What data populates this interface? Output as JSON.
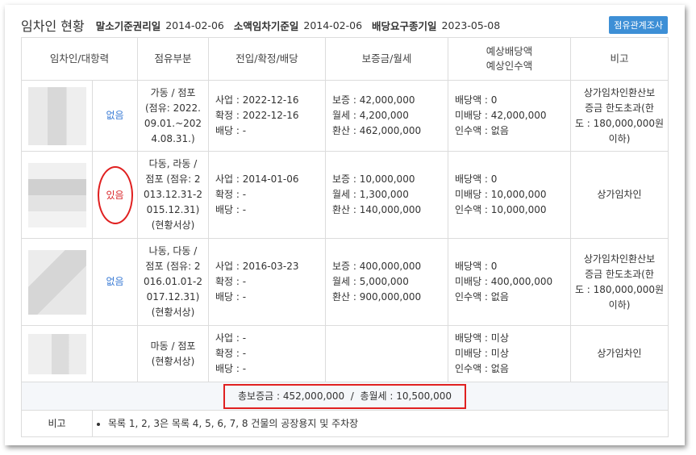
{
  "header": {
    "title": "임차인 현황",
    "items": [
      {
        "label": "말소기준권리일",
        "value": "2014-02-06"
      },
      {
        "label": "소액임차기준일",
        "value": "2014-02-06"
      },
      {
        "label": "배당요구종기일",
        "value": "2023-05-08"
      }
    ],
    "button": "점유관계조사"
  },
  "columns": [
    "임차인/대항력",
    "점유부분",
    "전입/확정/배당",
    "보증금/월세",
    "예상배당액\n예상인수액",
    "비고"
  ],
  "rows": [
    {
      "opposition": "없음",
      "area": "가동 / 점포\n(점유: 2022.\n09.01.~202\n4.08.31.)",
      "move": [
        "사업 : 2022-12-16",
        "확정 : 2022-12-16",
        "배당 : -"
      ],
      "deposit": [
        "보증 : 42,000,000",
        "월세 : 4,200,000",
        "환산 : 462,000,000"
      ],
      "dividend": [
        "배당액 : 0",
        "미배당 : 42,000,000",
        "인수액 : 없음"
      ],
      "note": "상가임차인환산보\n증금 한도초과(한\n도 : 180,000,000원\n이하)"
    },
    {
      "opposition": "있음",
      "area": "다동, 라동 /\n점포 (점유: 2\n013.12.31-2\n015.12.31)\n(현황서상)",
      "move": [
        "사업 : 2014-01-06",
        "확정 : -",
        "배당 : -"
      ],
      "deposit": [
        "보증 : 10,000,000",
        "월세 : 1,300,000",
        "환산 : 140,000,000"
      ],
      "dividend": [
        "배당액 : 0",
        "미배당 : 10,000,000",
        "인수액 : 10,000,000"
      ],
      "note": "상가임차인"
    },
    {
      "opposition": "없음",
      "area": "나동, 다동 /\n점포 (점유: 2\n016.01.01-2\n017.12.31)\n(현황서상)",
      "move": [
        "사업 : 2016-03-23",
        "확정 : -",
        "배당 : -"
      ],
      "deposit": [
        "보증 : 400,000,000",
        "월세 : 5,000,000",
        "환산 : 900,000,000"
      ],
      "dividend": [
        "배당액 : 0",
        "미배당 : 400,000,000",
        "인수액 : 없음"
      ],
      "note": "상가임차인환산보\n증금 한도초과(한\n도 : 180,000,000원\n이하)"
    },
    {
      "opposition": "",
      "area": "마동 / 점포\n(현황서상)",
      "move": [
        "사업 : -",
        "확정 : -",
        "배당 : -"
      ],
      "deposit": [
        "",
        "",
        ""
      ],
      "dividend": [
        "배당액 : 미상",
        "미배당 : 미상",
        "인수액 : 없음"
      ],
      "note": "상가임차인"
    }
  ],
  "total": "총보증금 : 452,000,000  /  총월세 : 10,500,000",
  "remarks": {
    "label": "비고",
    "item": "목록 1, 2, 3은 목록 4, 5, 6, 7, 8 건물의 공장용지 및 주차장"
  }
}
